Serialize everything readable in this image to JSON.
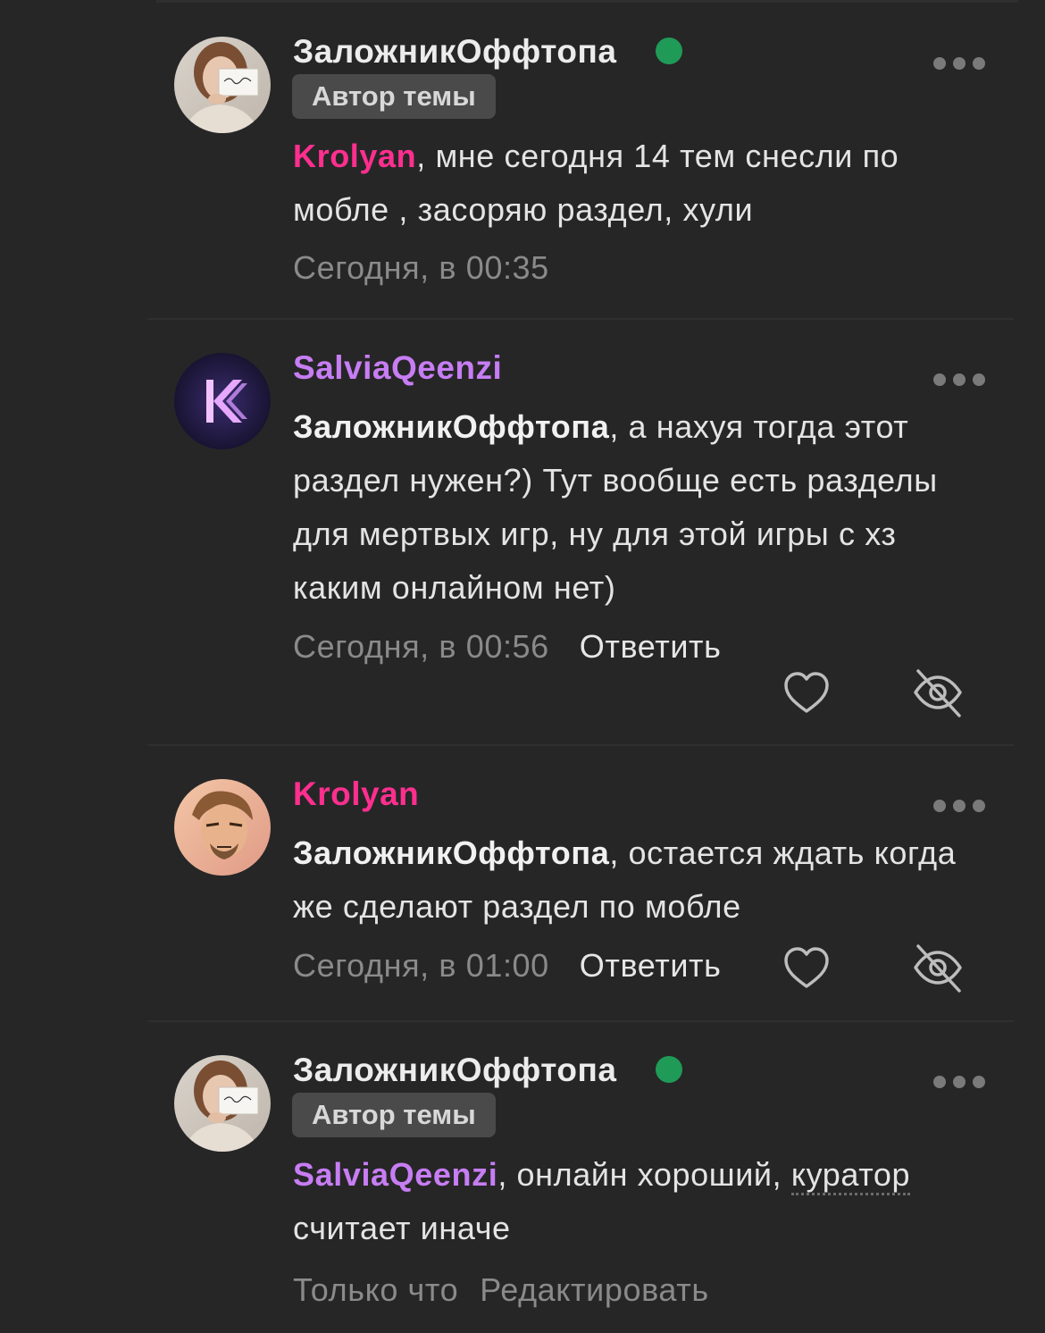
{
  "colors": {
    "background": "#262627",
    "author_name": "#ececec",
    "salvia_name": "#c77df3",
    "krolyan_name": "#ff2f8f",
    "online": "#1f9a57",
    "meta_grey": "#8a8a8b"
  },
  "posts": [
    {
      "author": "ЗаложникОффтопа",
      "online": true,
      "badge": "Автор темы",
      "mention": "Krolyan",
      "text": ", мне сегодня 14 тем снесли по мобле , засоряю раздел, хули",
      "time": "Сегодня, в 00:35"
    },
    {
      "author": "SalviaQeenzi",
      "mention": "ЗаложникОффтопа",
      "text": ", а нахуя тогда этот раздел нужен?) Тут вообще есть разделы для мертвых игр, ну для этой игры с хз каким онлайном нет)",
      "time": "Сегодня, в 00:56",
      "reply": "Ответить",
      "like_icon": "heart-icon",
      "hide_icon": "eye-slash-icon"
    },
    {
      "author": "Krolyan",
      "mention": "ЗаложникОффтопа",
      "text": ", остается ждать когда же сделают раздел по мобле",
      "time": "Сегодня, в 01:00",
      "reply": "Ответить",
      "like_icon": "heart-icon",
      "hide_icon": "eye-slash-icon"
    },
    {
      "author": "ЗаложникОффтопа",
      "online": true,
      "badge": "Автор темы",
      "mention": "SalviaQeenzi",
      "text_before": ", онлайн хороший, ",
      "text_dotted": "куратор",
      "text_after": " считает иначе",
      "time": "Только что",
      "edit": "Редактировать"
    }
  ]
}
